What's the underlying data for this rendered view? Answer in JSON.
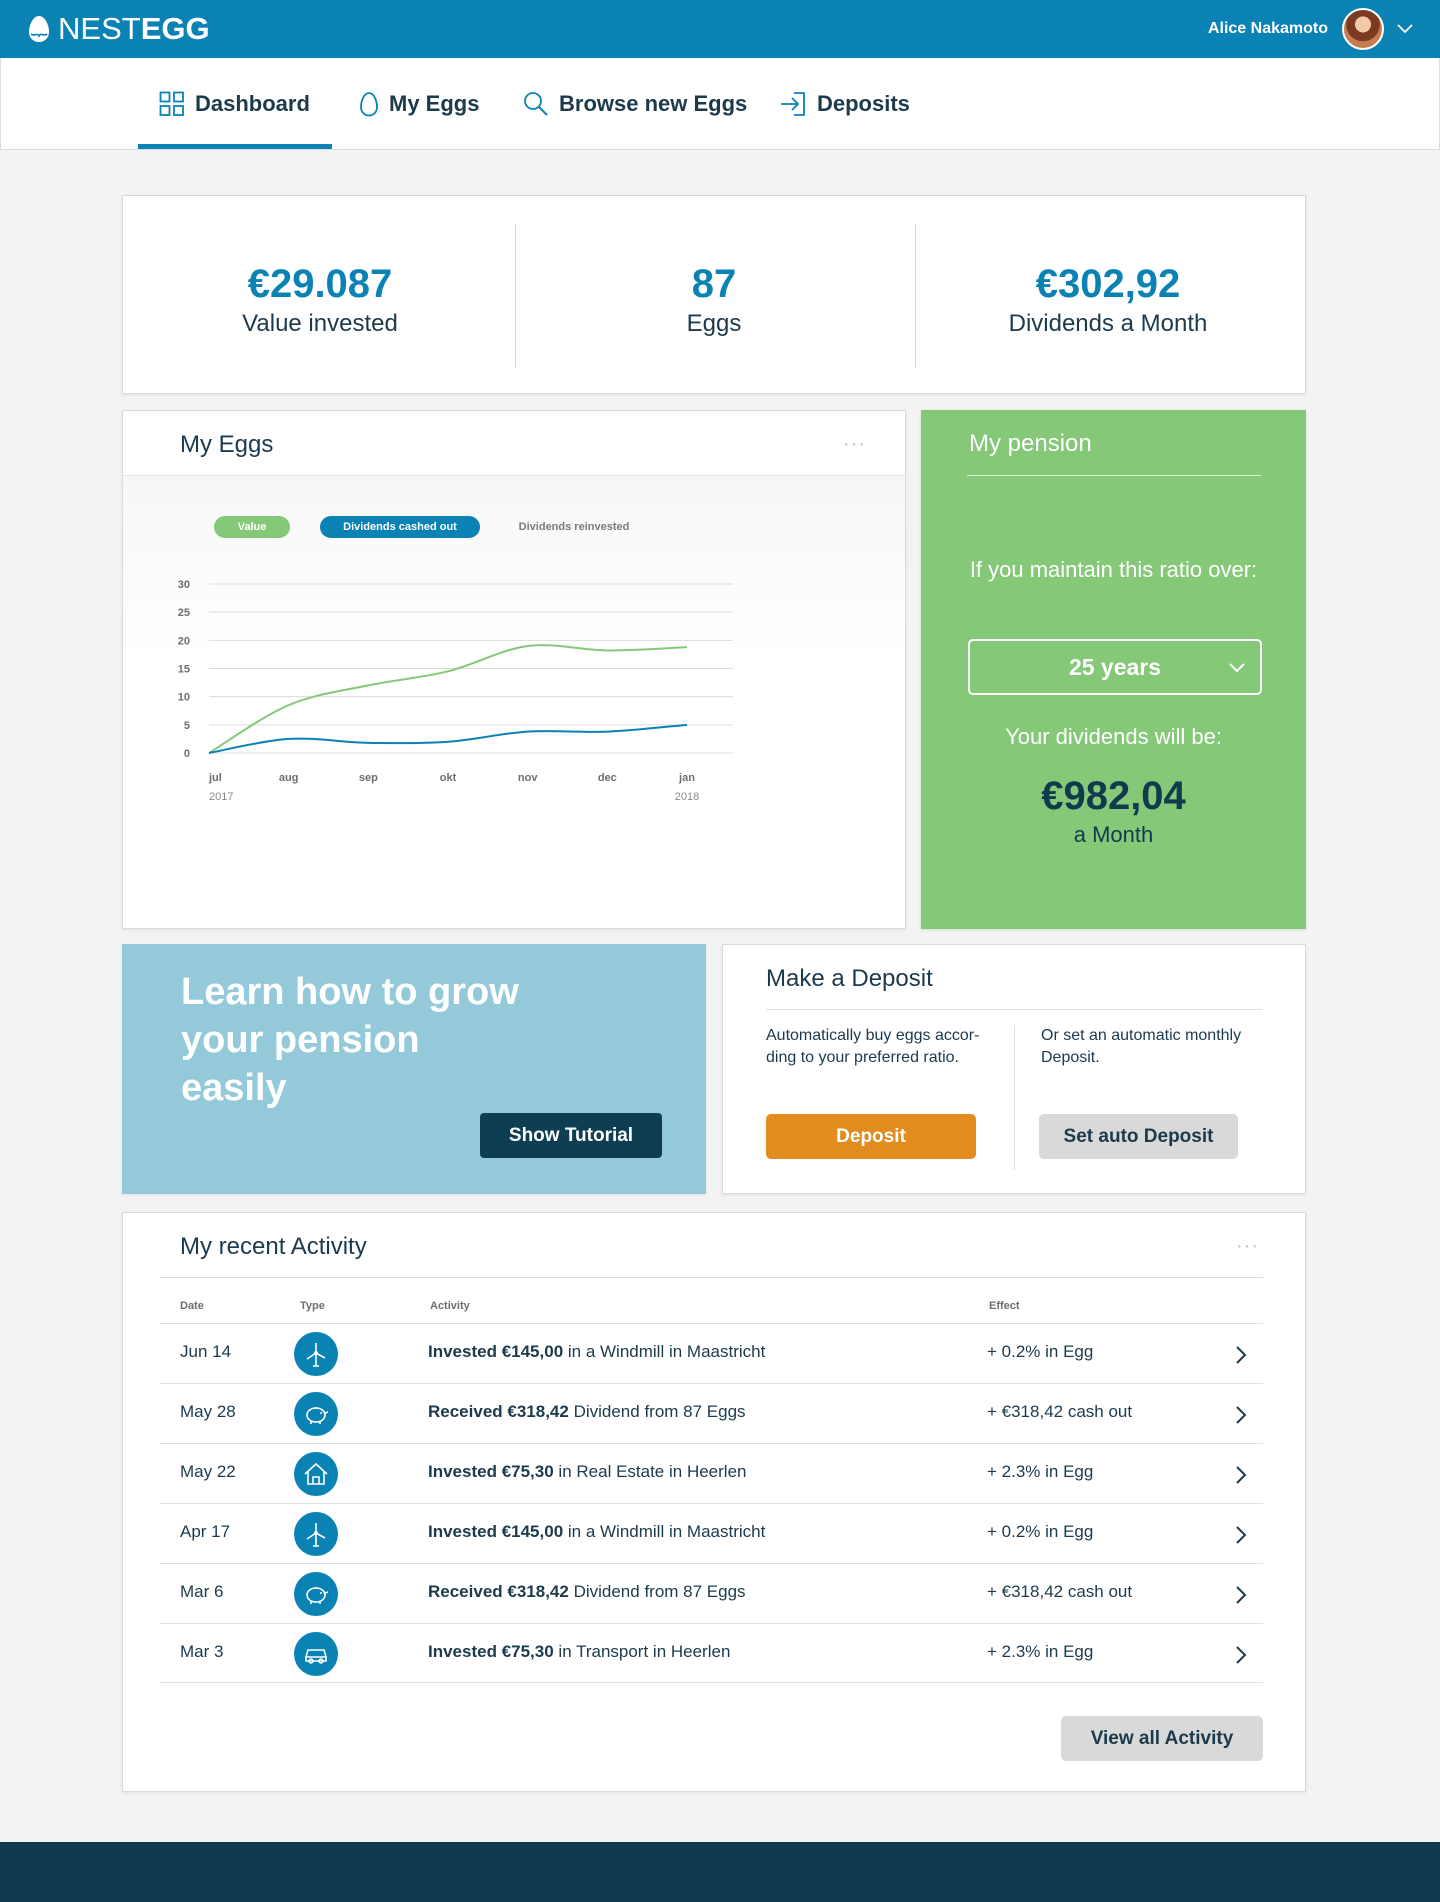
{
  "app": {
    "logo_light": "NEST",
    "logo_bold": "EGG",
    "user_name": "Alice Nakamoto"
  },
  "nav": {
    "dashboard": "Dashboard",
    "my_eggs": "My Eggs",
    "browse": "Browse new Eggs",
    "deposits": "Deposits",
    "active": "Dashboard"
  },
  "stats": {
    "value_invested": "€29.087",
    "value_invested_label": "Value invested",
    "eggs": "87",
    "eggs_label": "Eggs",
    "dividends": "€302,92",
    "dividends_label": "Dividends a Month"
  },
  "my_eggs": {
    "title": "My Eggs",
    "more": "···",
    "legend": {
      "value": "Value",
      "cashed_out": "Dividends cashed out",
      "reinvested": "Dividends reinvested"
    }
  },
  "chart_data": {
    "type": "line",
    "categories": [
      "jul",
      "aug",
      "sep",
      "okt",
      "nov",
      "dec",
      "jan"
    ],
    "category_years": [
      "2017",
      "",
      "",
      "",
      "",
      "",
      "2018"
    ],
    "y_ticks": [
      0,
      5,
      10,
      15,
      20,
      25,
      30
    ],
    "ylim": [
      0,
      30
    ],
    "grid": true,
    "legend_placement": "top-left",
    "series": [
      {
        "name": "Value",
        "color": "#84c878",
        "values": [
          0,
          8.5,
          12,
          14.5,
          19,
          18.2,
          18.8
        ]
      },
      {
        "name": "Dividends cashed out",
        "color": "#0a82b4",
        "values": [
          0,
          2.5,
          1.8,
          2.0,
          3.8,
          3.8,
          5.0
        ]
      }
    ]
  },
  "pension": {
    "title": "My pension",
    "question": "If you maintain this ratio over:",
    "selected_period": "25 years",
    "result_label": "Your dividends will be:",
    "amount": "€982,04",
    "unit": "a Month"
  },
  "learn": {
    "title": "Learn how to grow your pension easily",
    "button": "Show Tutorial"
  },
  "deposit": {
    "title": "Make a Deposit",
    "left_text": "Automatically buy eggs accor-ding to your preferred ratio.",
    "right_text": "Or set an automatic monthly Deposit.",
    "deposit_button": "Deposit",
    "auto_button": "Set auto Deposit"
  },
  "activity": {
    "title": "My recent Activity",
    "more": "···",
    "columns": {
      "date": "Date",
      "type": "Type",
      "activity": "Activity",
      "effect": "Effect"
    },
    "rows": [
      {
        "date": "Jun 14",
        "icon": "windmill-icon",
        "amount": "Invested €145,00",
        "rest": " in a Windmill in Maastricht",
        "effect": "+ 0.2% in Egg"
      },
      {
        "date": "May 28",
        "icon": "piggy-bank-icon",
        "amount": "Received €318,42",
        "rest": " Dividend from 87 Eggs",
        "effect": "+ €318,42 cash out"
      },
      {
        "date": "May 22",
        "icon": "house-icon",
        "amount": "Invested €75,30",
        "rest": " in Real Estate in Heerlen",
        "effect": "+ 2.3% in Egg"
      },
      {
        "date": "Apr 17",
        "icon": "windmill-icon",
        "amount": "Invested €145,00",
        "rest": " in a Windmill in Maastricht",
        "effect": "+ 0.2% in Egg"
      },
      {
        "date": "Mar 6",
        "icon": "piggy-bank-icon",
        "amount": "Received €318,42",
        "rest": " Dividend from 87 Eggs",
        "effect": "+ €318,42 cash out"
      },
      {
        "date": "Mar 3",
        "icon": "car-icon",
        "amount": "Invested €75,30",
        "rest": " in Transport in Heerlen",
        "effect": "+ 2.3% in Egg"
      }
    ],
    "view_all": "View all Activity"
  },
  "colors": {
    "brand_blue": "#0a82b4",
    "pension_green": "#84c878",
    "deposit_orange": "#e28c1f",
    "learn_blue": "#94c9da",
    "dark_navy": "#0f3a4f"
  }
}
